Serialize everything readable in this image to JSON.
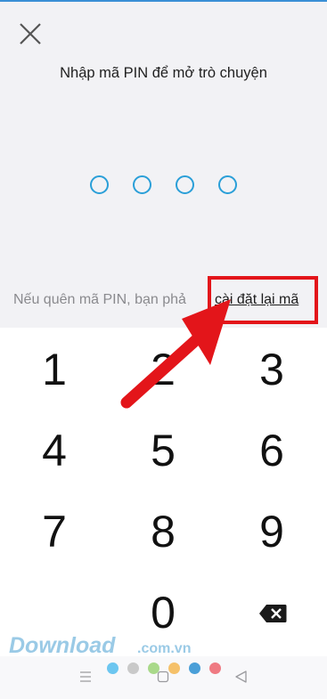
{
  "screen": {
    "title": "Nhập mã PIN để mở trò chuyện",
    "forgot_text": "Nếu quên mã PIN, bạn phả",
    "reset_link": "cài đặt lại mã"
  },
  "pin": {
    "length": 4,
    "entered": 0
  },
  "keypad": {
    "keys": [
      "1",
      "2",
      "3",
      "4",
      "5",
      "6",
      "7",
      "8",
      "9",
      "0"
    ]
  },
  "icons": {
    "close": "close-icon",
    "backspace": "backspace-icon",
    "nav_menu": "menu-icon",
    "nav_home": "home-icon",
    "nav_back": "back-icon"
  },
  "watermark": {
    "brand": "Download",
    "suffix": ".com.vn"
  },
  "colors": {
    "accent": "#2a9fd8",
    "highlight": "#e3151a",
    "watermark_dots": [
      "#6cc6f0",
      "#c9c9c9",
      "#a9d98a",
      "#f5c16a",
      "#4a9fd8",
      "#ef7a82"
    ]
  }
}
